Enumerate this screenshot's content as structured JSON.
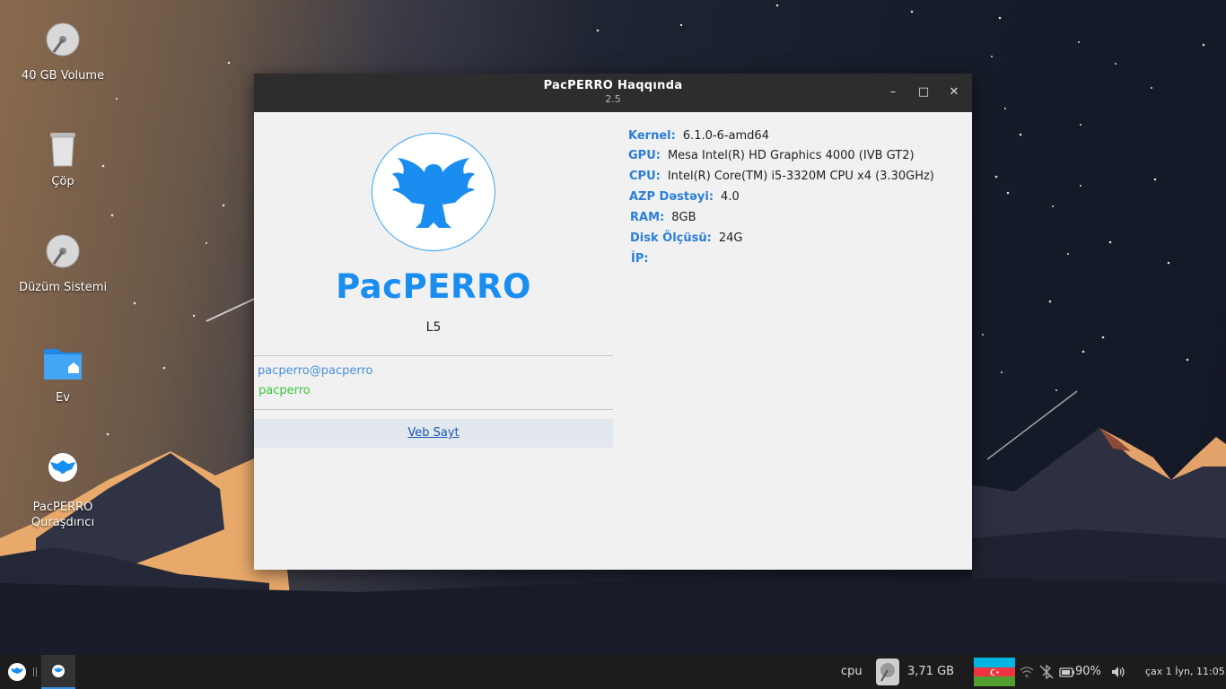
{
  "desktop": {
    "icons": [
      {
        "label": "40 GB Volume",
        "icon": "hard-drive-icon"
      },
      {
        "label": "Çöp",
        "icon": "trash-icon"
      },
      {
        "label": "Düzüm Sistemi",
        "icon": "hard-drive-icon"
      },
      {
        "label": "Ev",
        "icon": "home-folder-icon"
      },
      {
        "label": "PacPERRO Quraşdırıcı",
        "icon": "installer-icon"
      }
    ]
  },
  "window": {
    "title": "PacPERRO Haqqında",
    "subtitle": "2.5",
    "brand": "PacPERRO",
    "edition": "L5",
    "user_host": "pacperro@pacperro",
    "user_name": "pacperro",
    "website_label": "Veb Sayt",
    "info": [
      {
        "key": "Kernel:",
        "value": "6.1.0-6-amd64"
      },
      {
        "key": "GPU:",
        "value": "Mesa Intel(R) HD Graphics 4000 (IVB GT2)"
      },
      {
        "key": "CPU:",
        "value": "Intel(R) Core(TM) i5-3320M CPU x4 (3.30GHz)"
      },
      {
        "key": "AZP Dəstəyi:",
        "value": "4.0"
      },
      {
        "key": "RAM:",
        "value": "8GB"
      },
      {
        "key": "Disk Ölçüsü:",
        "value": "24G"
      },
      {
        "key": "İP:",
        "value": ""
      }
    ],
    "controls": {
      "minimize": "–",
      "maximize": "□",
      "close": "✕"
    }
  },
  "taskbar": {
    "cpu_label": "cpu",
    "disk_free": "3,71 GB",
    "battery": "90%",
    "clock": "çax 1 İyn, 11:05"
  },
  "colors": {
    "accent": "#1a8ef0",
    "titlebar": "#2d2d2d",
    "flag_blue": "#00b5e2",
    "flag_red": "#ef3340",
    "flag_green": "#509e2f"
  }
}
